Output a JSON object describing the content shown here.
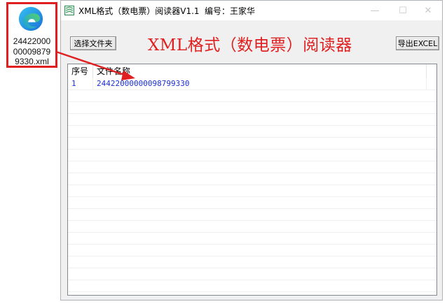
{
  "desktop": {
    "file_name": "24422000\n00009879\n9330.xml",
    "highlight_color": "#e02020"
  },
  "window": {
    "title": "XML格式（数电票）阅读器V1.1",
    "author": "编号：王家华",
    "minimize_symbol": "—",
    "maximize_symbol": "☐",
    "close_symbol": "✕"
  },
  "toolbar": {
    "select_folder_label": "选择文件夹",
    "export_excel_label": "导出EXCEL",
    "app_title": "XML格式（数电票）阅读器"
  },
  "table": {
    "columns": [
      "序号",
      "文件名称"
    ],
    "rows": [
      [
        "1",
        "24422000000098799330"
      ]
    ]
  },
  "colors": {
    "accent_red": "#e02020",
    "row_text": "#1b2fd0"
  }
}
